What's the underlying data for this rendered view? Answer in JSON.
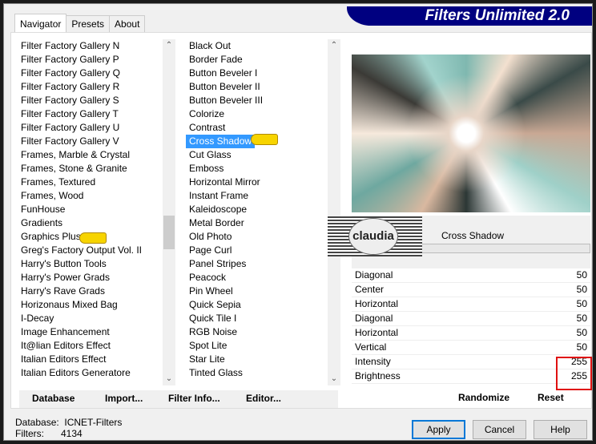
{
  "app_title": "Filters Unlimited 2.0",
  "tabs": [
    {
      "label": "Navigator"
    },
    {
      "label": "Presets"
    },
    {
      "label": "About"
    }
  ],
  "categories": [
    "Filter Factory Gallery N",
    "Filter Factory Gallery P",
    "Filter Factory Gallery Q",
    "Filter Factory Gallery R",
    "Filter Factory Gallery S",
    "Filter Factory Gallery T",
    "Filter Factory Gallery U",
    "Filter Factory Gallery V",
    "Frames, Marble & Crystal",
    "Frames, Stone & Granite",
    "Frames, Textured",
    "Frames, Wood",
    "FunHouse",
    "Gradients",
    "Graphics Plus",
    "Greg's Factory Output Vol. II",
    "Harry's Button Tools",
    "Harry's Power Grads",
    "Harry's Rave Grads",
    "Horizonaus Mixed Bag",
    "I-Decay",
    "Image Enhancement",
    "It@lian Editors Effect",
    "Italian Editors Effect",
    "Italian Editors Generatore"
  ],
  "filters": [
    "Black Out",
    "Border Fade",
    "Button Beveler I",
    "Button Beveler II",
    "Button Beveler III",
    "Colorize",
    "Contrast",
    "Cross Shadow",
    "Cut Glass",
    "Emboss",
    "Horizontal Mirror",
    "Instant Frame",
    "Kaleidoscope",
    "Metal Border",
    "Old Photo",
    "Page Curl",
    "Panel Stripes",
    "Peacock",
    "Pin Wheel",
    "Quick Sepia",
    "Quick Tile I",
    "RGB Noise",
    "Spot Lite",
    "Star Lite",
    "Tinted Glass"
  ],
  "selected_filter": "Cross Shadow",
  "filter_name": "Cross Shadow",
  "logo_text": "claudia",
  "params": [
    {
      "label": "Diagonal",
      "value": "50"
    },
    {
      "label": "Center",
      "value": "50"
    },
    {
      "label": "Horizontal",
      "value": "50"
    },
    {
      "label": "Diagonal",
      "value": "50"
    },
    {
      "label": "Horizontal",
      "value": "50"
    },
    {
      "label": "Vertical",
      "value": "50"
    },
    {
      "label": "Intensity",
      "value": "255"
    },
    {
      "label": "Brightness",
      "value": "255"
    }
  ],
  "buttons": {
    "database": "Database",
    "import": "Import...",
    "filter_info": "Filter Info...",
    "editor": "Editor...",
    "randomize": "Randomize",
    "reset": "Reset",
    "apply": "Apply",
    "cancel": "Cancel",
    "help": "Help"
  },
  "status": {
    "database_label": "Database:",
    "database_value": "ICNET-Filters",
    "filters_label": "Filters:",
    "filters_value": "4134"
  },
  "colors": {
    "banner": "#000080",
    "selection": "#3399ff",
    "highlight_box": "#e01010"
  }
}
